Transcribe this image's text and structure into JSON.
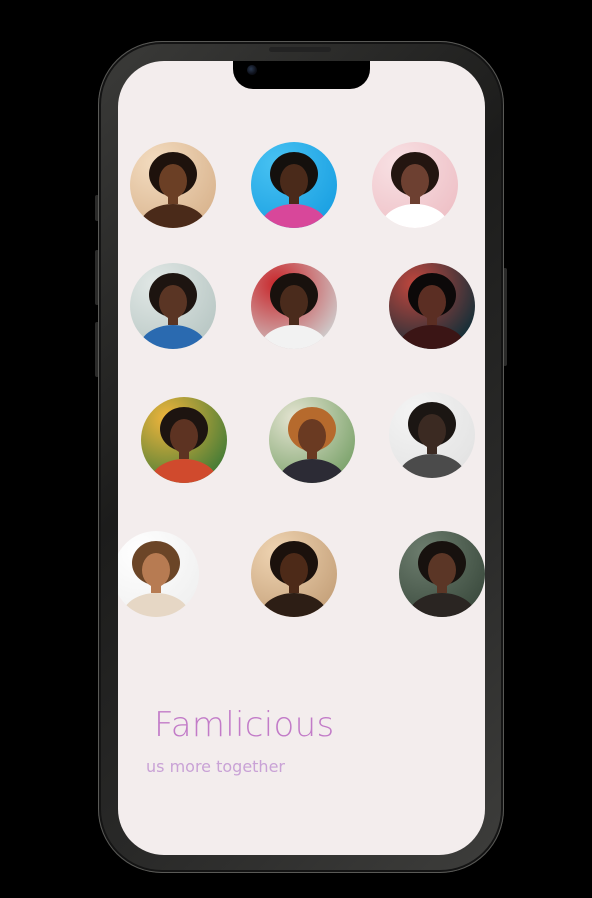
{
  "app": {
    "title": "Famlicious",
    "tagline": "us more together"
  },
  "colors": {
    "screen_background": "#f3eded",
    "title": "#c27bc8",
    "tagline": "#c9a2d6",
    "frame": "#2a2a29",
    "outer_background": "#000000"
  },
  "avatars": [
    {
      "id": "avatar-1",
      "bg": "#d9b48e",
      "skin": "#6b3f25",
      "hair": "#1e120c",
      "cloth": "#4a2a19",
      "light": "#f3dcc0"
    },
    {
      "id": "avatar-2",
      "bg": "#1aa0e2",
      "skin": "#4a2a1a",
      "hair": "#14100d",
      "cloth": "#d8479a",
      "light": "#48c2f2"
    },
    {
      "id": "avatar-3",
      "bg": "#eec0c6",
      "skin": "#6d4031",
      "hair": "#231510",
      "cloth": "#ffffff",
      "light": "#f8e1e4"
    },
    {
      "id": "avatar-4",
      "bg": "#b8c7c4",
      "skin": "#5a3524",
      "hair": "#1d1410",
      "cloth": "#2a6ab0",
      "light": "#e2e8e6"
    },
    {
      "id": "avatar-5",
      "bg": "#cfcfcf",
      "skin": "#4a2b1c",
      "hair": "#18110d",
      "cloth": "#f2f2f2",
      "light": "#c8262a"
    },
    {
      "id": "avatar-6",
      "bg": "#0e2e38",
      "skin": "#5b2e23",
      "hair": "#0c0909",
      "cloth": "#3b1515",
      "light": "#c2463d"
    },
    {
      "id": "avatar-7",
      "bg": "#3f7a36",
      "skin": "#5d3322",
      "hair": "#1d1410",
      "cloth": "#d04a2d",
      "light": "#f1b53c"
    },
    {
      "id": "avatar-8",
      "bg": "#7aa26a",
      "skin": "#6a3a22",
      "hair": "#b66a2d",
      "cloth": "#2c2b35",
      "light": "#e5e4d2"
    },
    {
      "id": "avatar-9",
      "bg": "#e3e3e3",
      "skin": "#3b2a22",
      "hair": "#1b1613",
      "cloth": "#4b4b4b",
      "light": "#f4f4f4"
    },
    {
      "id": "avatar-10",
      "bg": "#f0f0f0",
      "skin": "#b77b52",
      "hair": "#6b4527",
      "cloth": "#e6d7c5",
      "light": "#ffffff"
    },
    {
      "id": "avatar-11",
      "bg": "#c5a17a",
      "skin": "#4d2a18",
      "hair": "#1b110c",
      "cloth": "#2d1e15",
      "light": "#efd4b2"
    },
    {
      "id": "avatar-12",
      "bg": "#3b4b3e",
      "skin": "#5b3626",
      "hair": "#17110e",
      "cloth": "#2a2522",
      "light": "#6d7d6e"
    }
  ]
}
